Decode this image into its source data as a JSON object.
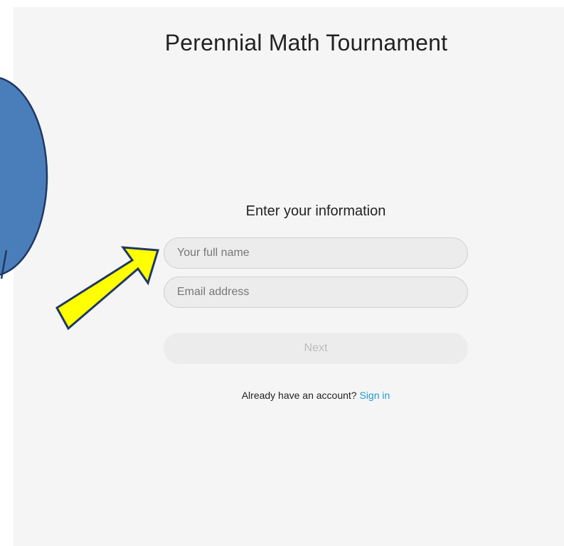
{
  "app": {
    "title": "Perennial Math Tournament"
  },
  "form": {
    "heading": "Enter your information",
    "name_placeholder": "Your full name",
    "name_value": "",
    "email_placeholder": "Email address",
    "email_value": "",
    "next_label": "Next"
  },
  "signin": {
    "prompt": "Already have an account?",
    "link_label": "Sign in"
  },
  "annotations": {
    "circle_color": "#4a7ebb",
    "arrow_color": "#ffff00",
    "arrow_outline": "#1f3864"
  },
  "colors": {
    "panel_bg": "#f5f5f5",
    "link": "#1f9bd1",
    "disabled_text": "#bdbdbd"
  }
}
